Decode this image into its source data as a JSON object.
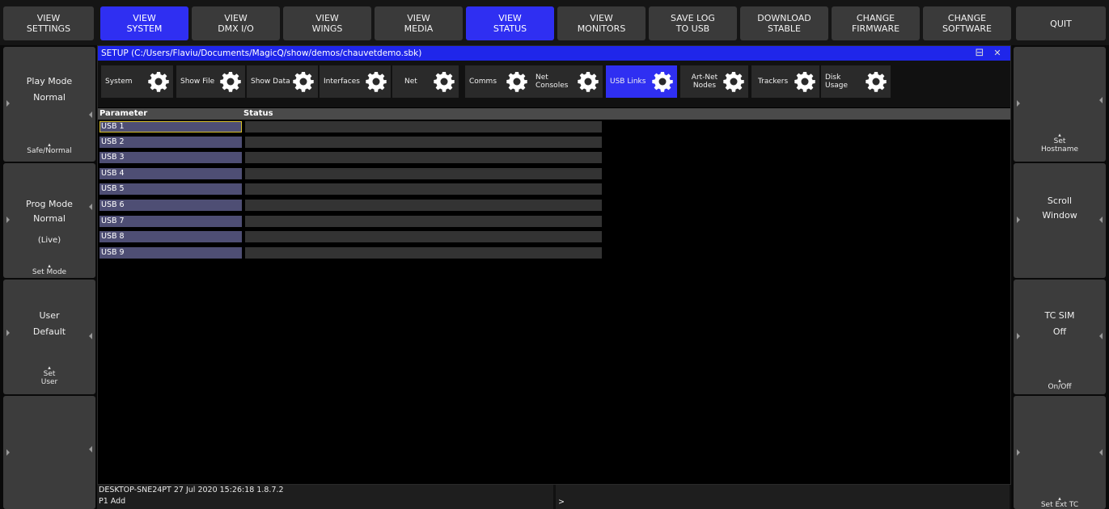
{
  "top_buttons": [
    {
      "label": "VIEW\nSETTINGS",
      "active": false
    },
    {
      "label": "VIEW\nSYSTEM",
      "active": true
    },
    {
      "label": "VIEW\nDMX I/O",
      "active": false
    },
    {
      "label": "VIEW\nWINGS",
      "active": false
    },
    {
      "label": "VIEW\nMEDIA",
      "active": false
    },
    {
      "label": "VIEW\nSTATUS",
      "active": true
    },
    {
      "label": "VIEW\nMONITORS",
      "active": false
    },
    {
      "label": "SAVE LOG\nTO USB",
      "active": false
    },
    {
      "label": "DOWNLOAD\nSTABLE",
      "active": false
    },
    {
      "label": "CHANGE\nFIRMWARE",
      "active": false
    },
    {
      "label": "CHANGE\nSOFTWARE",
      "active": false
    },
    {
      "label": "QUIT",
      "active": false
    }
  ],
  "left_panel": {
    "play_mode": {
      "title": "Play Mode",
      "value": "Normal",
      "action": "Safe/Normal"
    },
    "prog_mode": {
      "title": "Prog Mode",
      "value": "Normal",
      "note": "(Live)",
      "action": "Set Mode"
    },
    "user": {
      "title": "User",
      "value": "Default",
      "action_line1": "Set",
      "action_line2": "User"
    }
  },
  "right_panel": {
    "hostname": {
      "action_line1": "Set",
      "action_line2": "Hostname"
    },
    "scroll": {
      "title": "Scroll",
      "value": "Window"
    },
    "tc_sim": {
      "title": "TC SIM",
      "value": "Off",
      "action": "On/Off"
    },
    "ext_tc": {
      "action": "Set Ext TC"
    }
  },
  "window": {
    "title": "SETUP (C:/Users/Flaviu/Documents/MagicQ/show/demos/chauvetdemo.sbk)",
    "restore_glyph": "⊟",
    "close_glyph": "✕"
  },
  "tabs": [
    {
      "label": "System",
      "active": false
    },
    {
      "label": "Show File",
      "active": false
    },
    {
      "label": "Show Data",
      "active": false
    },
    {
      "label": "Interfaces",
      "active": false
    },
    {
      "label": "Net",
      "active": false
    },
    {
      "label": "Comms",
      "active": false
    },
    {
      "label": "Net Consoles",
      "active": false
    },
    {
      "label": "USB Links",
      "active": true
    },
    {
      "label": "Art-Net\nNodes",
      "active": false
    },
    {
      "label": "Trackers",
      "active": false
    },
    {
      "label": "Disk Usage",
      "active": false
    }
  ],
  "table": {
    "columns": [
      "Parameter",
      "Status"
    ],
    "rows": [
      {
        "parameter": "USB 1",
        "status": ""
      },
      {
        "parameter": "USB 2",
        "status": ""
      },
      {
        "parameter": "USB 3",
        "status": ""
      },
      {
        "parameter": "USB 4",
        "status": ""
      },
      {
        "parameter": "USB 5",
        "status": ""
      },
      {
        "parameter": "USB 6",
        "status": ""
      },
      {
        "parameter": "USB 7",
        "status": ""
      },
      {
        "parameter": "USB 8",
        "status": ""
      },
      {
        "parameter": "USB 9",
        "status": ""
      }
    ]
  },
  "status_bar": {
    "info": "DESKTOP-SNE24PT 27 Jul 2020 15:26:18 1.8.7.2",
    "command": "P1 Add",
    "prompt": ">"
  },
  "colors": {
    "accent": "#2f2ff2",
    "title_bar": "#1f26ea",
    "selection_border": "#d8c02a"
  }
}
